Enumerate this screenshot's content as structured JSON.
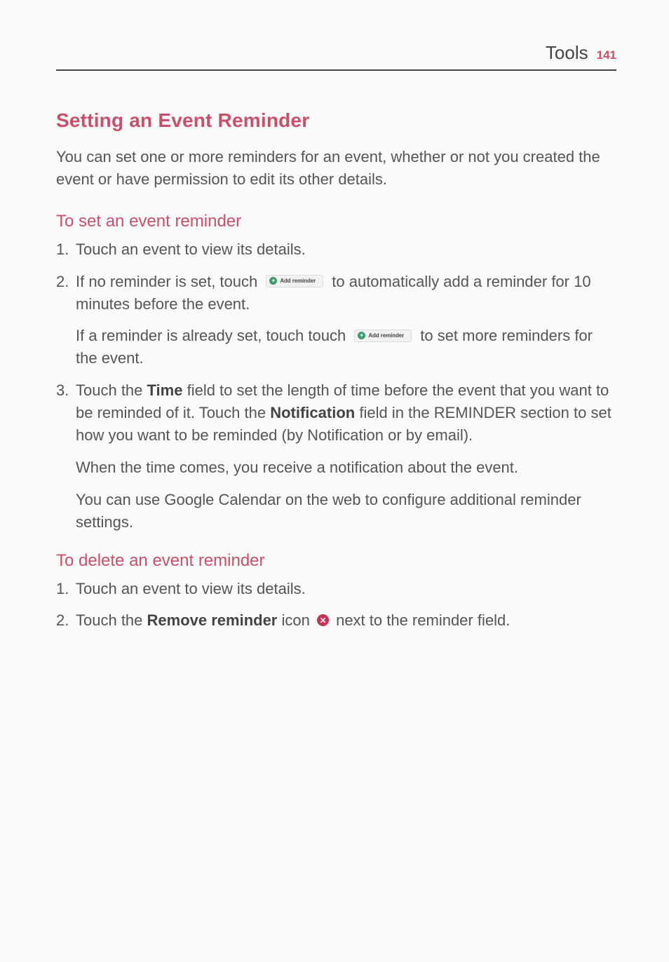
{
  "header": {
    "title": "Tools",
    "page": "141"
  },
  "section": {
    "title": "Setting an Event Reminder",
    "intro": "You can set one or more reminders for an event, whether or not you created the event or have permission to edit its other details."
  },
  "set_reminder": {
    "title": "To set an event reminder",
    "items": {
      "i1": "Touch an event to view its details.",
      "i2_a": "If no reminder is set, touch ",
      "i2_b": " to automatically add a reminder for 10 minutes before the event.",
      "i2_sub_a": "If a reminder is already set, touch touch ",
      "i2_sub_b": " to set more reminders for the event.",
      "i3_a": "Touch the ",
      "i3_time": "Time",
      "i3_b": " field to set the length of time before the event that you want to be reminded of it. Touch the ",
      "i3_notification": "Notification",
      "i3_c": " field in the REMINDER section to set how you want to be reminded (by Notification or by email).",
      "i3_sub1": "When the time comes, you receive a notification about the event.",
      "i3_sub2": "You can use Google Calendar on the web to configure additional reminder settings."
    }
  },
  "delete_reminder": {
    "title": "To delete an event reminder",
    "items": {
      "i1": "Touch an event to view its details.",
      "i2_a": "Touch the ",
      "i2_bold": "Remove reminder",
      "i2_b": " icon ",
      "i2_c": " next to the reminder field."
    }
  },
  "badge": {
    "label": "Add reminder",
    "plus": "+"
  },
  "remove_icon_glyph": "✕"
}
